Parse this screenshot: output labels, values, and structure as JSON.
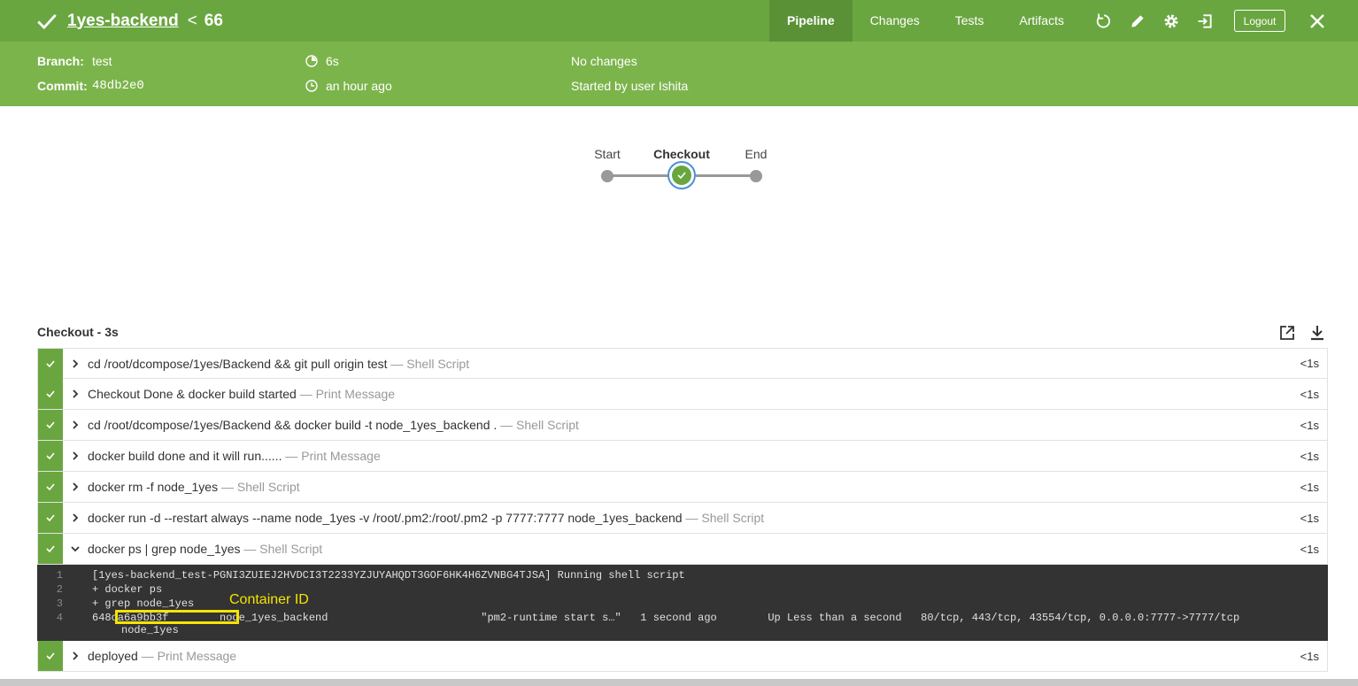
{
  "header": {
    "project": "1yes-backend",
    "separator": "<",
    "run_number": "66",
    "tabs": [
      "Pipeline",
      "Changes",
      "Tests",
      "Artifacts"
    ],
    "active_tab": "Pipeline",
    "logout_label": "Logout",
    "accent": "#6aa640"
  },
  "summary": {
    "branch_label": "Branch:",
    "branch": "test",
    "commit_label": "Commit:",
    "commit": "48db2e0",
    "duration": "6s",
    "time_ago": "an hour ago",
    "changes": "No changes",
    "started_by": "Started by user Ishita"
  },
  "graph": {
    "start": "Start",
    "stage": "Checkout",
    "end": "End"
  },
  "steps_header": "Checkout - 3s",
  "steps": [
    {
      "cmd": "cd /root/dcompose/1yes/Backend && git pull origin test",
      "kind": "— Shell Script",
      "dur": "<1s"
    },
    {
      "cmd": "Checkout Done & docker build started",
      "kind": "— Print Message",
      "dur": "<1s"
    },
    {
      "cmd": "cd /root/dcompose/1yes/Backend && docker build -t node_1yes_backend .",
      "kind": "— Shell Script",
      "dur": "<1s"
    },
    {
      "cmd": "docker build done and it will run......",
      "kind": "— Print Message",
      "dur": "<1s"
    },
    {
      "cmd": "docker rm -f node_1yes",
      "kind": "— Shell Script",
      "dur": "<1s"
    },
    {
      "cmd": "docker run -d --restart always --name node_1yes -v /root/.pm2:/root/.pm2 -p 7777:7777 node_1yes_backend",
      "kind": "— Shell Script",
      "dur": "<1s"
    },
    {
      "cmd": "docker ps | grep node_1yes",
      "kind": "— Shell Script",
      "dur": "<1s"
    },
    {
      "cmd": "deployed",
      "kind": "— Print Message",
      "dur": "<1s"
    }
  ],
  "log": {
    "lines": [
      {
        "n": "1",
        "text": "[1yes-backend_test-PGNI3ZUIEJ2HVDCI3T2233YZJUYAHQDT3GOF6HK4H6ZVNBG4TJSA] Running shell script"
      },
      {
        "n": "2",
        "text": "+ docker ps"
      },
      {
        "n": "3",
        "text": "+ grep node_1yes"
      },
      {
        "n": "4",
        "text": "648ca6a9bb3f        node_1yes_backend                        \"pm2-runtime start s…\"   1 second ago        Up Less than a second   80/tcp, 443/tcp, 43554/tcp, 0.0.0.0:7777->7777/tcp"
      }
    ],
    "wrap": "node_1yes",
    "annotation": "Container ID"
  }
}
